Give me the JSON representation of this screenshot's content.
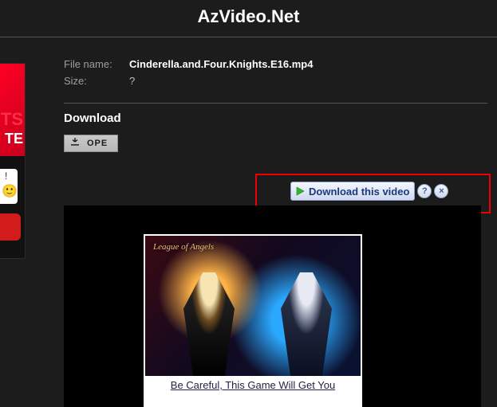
{
  "header": {
    "title": "AzVideo.Net"
  },
  "info": {
    "file_name_label": "File name:",
    "file_name_value": "Cinderella.and.Four.Knights.E16.mp4",
    "size_label": "Size:",
    "size_value": "?"
  },
  "download": {
    "heading": "Download",
    "ope_button_label": "OPE"
  },
  "toolbar": {
    "download_video_label": "Download this video",
    "help_char": "?",
    "close_char": "×"
  },
  "left_ad": {
    "fragment1": "TS",
    "fragment2": "TE",
    "bang": "!",
    "smile": "🙂"
  },
  "game_ad": {
    "logo": "League of Angels",
    "caption": "Be Careful, This Game Will Get You"
  }
}
